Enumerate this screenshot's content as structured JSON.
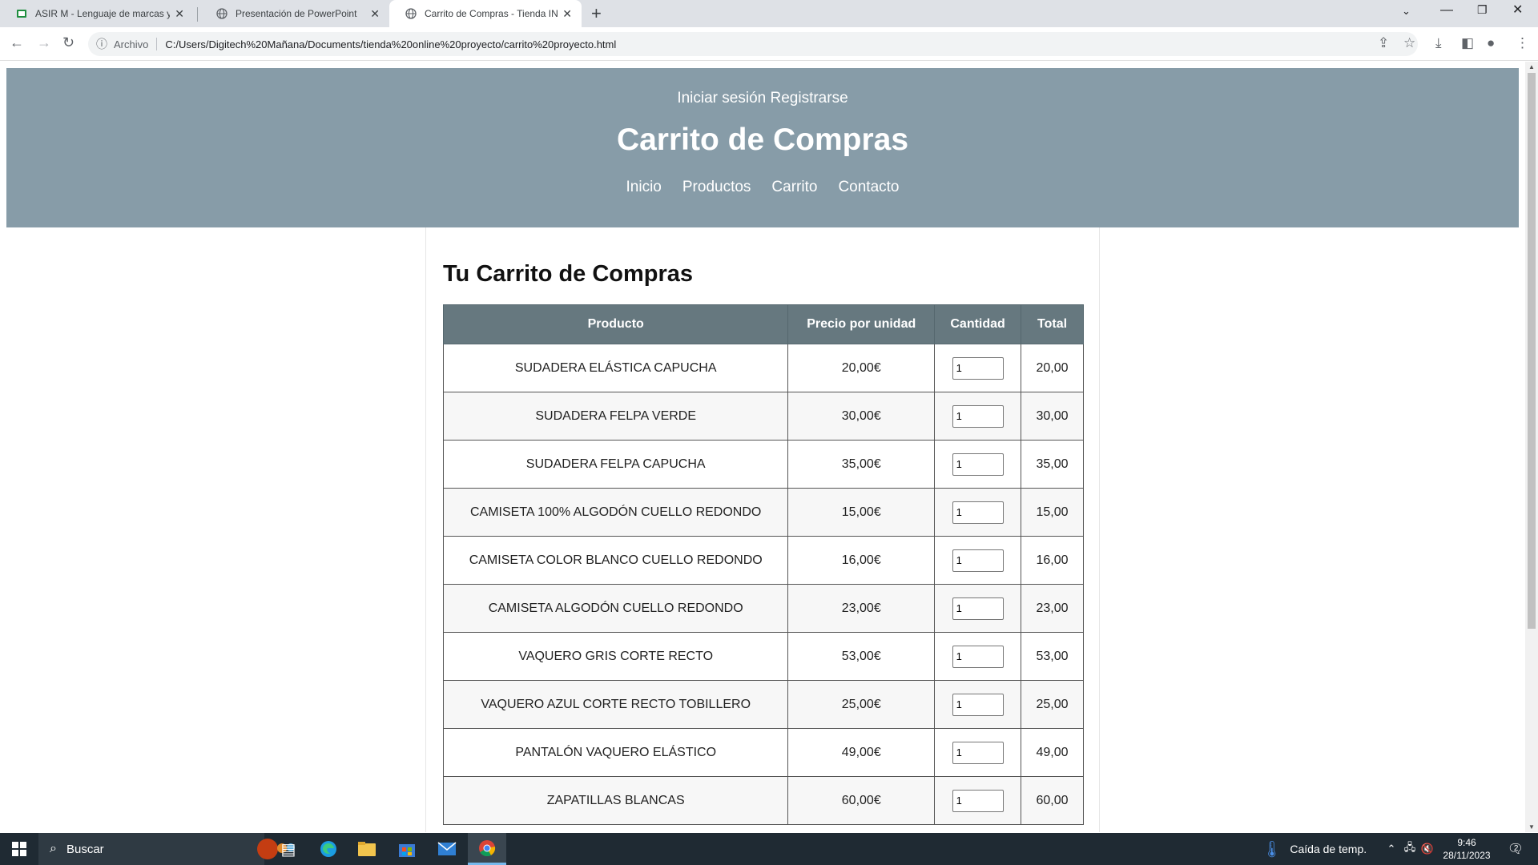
{
  "browser": {
    "tabs": [
      {
        "title": "ASIR M - Lenguaje de marcas y s",
        "active": false,
        "favicon": "classroom-icon"
      },
      {
        "title": "Presentación de PowerPoint",
        "active": false,
        "favicon": "globe-icon"
      },
      {
        "title": "Carrito de Compras - Tienda ING",
        "active": true,
        "favicon": "globe-icon"
      }
    ],
    "address_scheme": "Archivo",
    "address_url": "C:/Users/Digitech%20Mañana/Documents/tienda%20online%20proyecto/carrito%20proyecto.html"
  },
  "site": {
    "auth": {
      "login": "Iniciar sesión",
      "register": "Registrarse"
    },
    "title": "Carrito de Compras",
    "nav": [
      "Inicio",
      "Productos",
      "Carrito",
      "Contacto"
    ]
  },
  "cart": {
    "heading": "Tu Carrito de Compras",
    "columns": [
      "Producto",
      "Precio por unidad",
      "Cantidad",
      "Total"
    ],
    "rows": [
      {
        "product": "SUDADERA ELÁSTICA CAPUCHA",
        "price": "20,00€",
        "qty": "1",
        "total": "20,00"
      },
      {
        "product": "SUDADERA FELPA VERDE",
        "price": "30,00€",
        "qty": "1",
        "total": "30,00"
      },
      {
        "product": "SUDADERA FELPA CAPUCHA",
        "price": "35,00€",
        "qty": "1",
        "total": "35,00"
      },
      {
        "product": "CAMISETA 100% ALGODÓN CUELLO REDONDO",
        "price": "15,00€",
        "qty": "1",
        "total": "15,00"
      },
      {
        "product": "CAMISETA COLOR BLANCO CUELLO REDONDO",
        "price": "16,00€",
        "qty": "1",
        "total": "16,00"
      },
      {
        "product": "CAMISETA ALGODÓN CUELLO REDONDO",
        "price": "23,00€",
        "qty": "1",
        "total": "23,00"
      },
      {
        "product": "VAQUERO GRIS CORTE RECTO",
        "price": "53,00€",
        "qty": "1",
        "total": "53,00"
      },
      {
        "product": "VAQUERO AZUL CORTE RECTO TOBILLERO",
        "price": "25,00€",
        "qty": "1",
        "total": "25,00"
      },
      {
        "product": "PANTALÓN VAQUERO ELÁSTICO",
        "price": "49,00€",
        "qty": "1",
        "total": "49,00"
      },
      {
        "product": "ZAPATILLAS BLANCAS",
        "price": "60,00€",
        "qty": "1",
        "total": "60,00"
      }
    ]
  },
  "taskbar": {
    "search_placeholder": "Buscar",
    "weather": "Caída de temp.",
    "time": "9:46",
    "date": "28/11/2023",
    "notifications": "2"
  },
  "colors": {
    "header_bg": "#879ca8",
    "table_header_bg": "#66787f",
    "taskbar_bg": "#1f2a33"
  }
}
